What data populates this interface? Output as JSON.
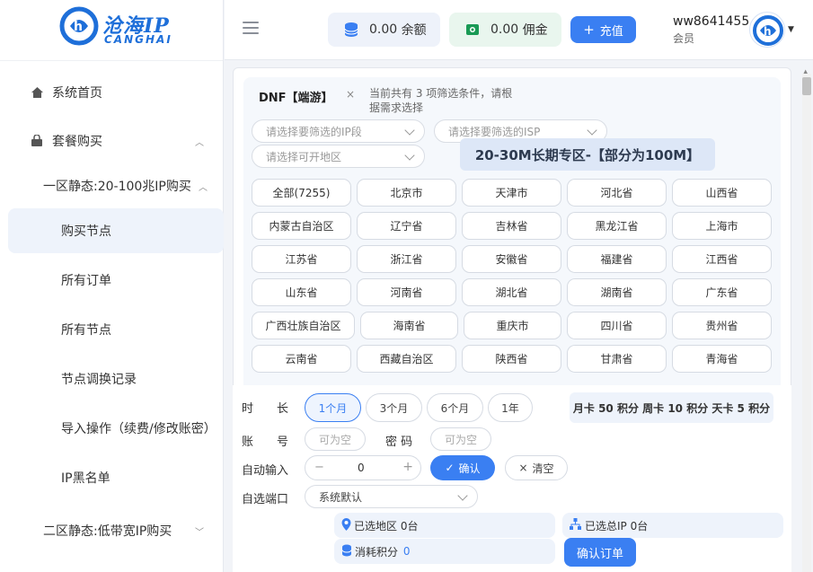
{
  "brand": {
    "title": "沧海IP",
    "subtitle": "CANGHAI"
  },
  "sidebar": {
    "items": [
      {
        "label": "系统首页",
        "icon": "home-icon"
      },
      {
        "label": "套餐购买",
        "icon": "bag-icon",
        "expanded": true
      },
      {
        "label": "一区静态:20-100兆IP购买",
        "expanded": true
      },
      {
        "label": "购买节点",
        "active": true
      },
      {
        "label": "所有订单"
      },
      {
        "label": "所有节点"
      },
      {
        "label": "节点调换记录"
      },
      {
        "label": "导入操作（续费/修改账密）"
      },
      {
        "label": "IP黑名单"
      },
      {
        "label": "二区静态:低带宽IP购买",
        "expanded": false
      }
    ]
  },
  "header": {
    "balance": {
      "value": "0.00",
      "label": "余额",
      "icon": "coins-icon"
    },
    "commission": {
      "value": "0.00",
      "label": "佣金",
      "icon": "cash-icon"
    },
    "recharge_label": "充值",
    "user": {
      "name": "ww8641455",
      "role": "会员"
    }
  },
  "filter": {
    "game": "DNF【端游】",
    "close": "×",
    "hint": "当前共有 3 项筛选条件，请根据需求选择",
    "ip_segment_placeholder": "请选择要筛选的IP段",
    "isp_placeholder": "请选择要筛选的ISP",
    "region_placeholder": "请选择可开地区",
    "banner": "20-30M长期专区-【部分为100M】",
    "regions": [
      "全部(7255)",
      "北京市",
      "天津市",
      "河北省",
      "山西省",
      "内蒙古自治区",
      "辽宁省",
      "吉林省",
      "黑龙江省",
      "上海市",
      "江苏省",
      "浙江省",
      "安徽省",
      "福建省",
      "江西省",
      "山东省",
      "河南省",
      "湖北省",
      "湖南省",
      "广东省",
      "广西壮族自治区",
      "海南省",
      "重庆市",
      "四川省",
      "贵州省",
      "云南省",
      "西藏自治区",
      "陕西省",
      "甘肃省",
      "青海省"
    ]
  },
  "form": {
    "duration_label": "时　　长",
    "durations": [
      "1个月",
      "3个月",
      "6个月",
      "1年"
    ],
    "selected_duration": "1个月",
    "points_note": "月卡 50 积分 周卡 10 积分 天卡 5 积分",
    "account_label": "账　　号",
    "account_placeholder": "可为空",
    "password_label": "密 码",
    "password_placeholder": "可为空",
    "auto_input_label": "自动输入",
    "stepper": {
      "minus": "−",
      "value": "0",
      "plus": "+"
    },
    "confirm_label": "确认",
    "clear_label": "清空",
    "port_label": "自选端口",
    "port_value": "系统默认",
    "selected_region_label": "已选地区",
    "selected_region_value": "0台",
    "selected_ip_label": "已选总IP",
    "selected_ip_value": "0台",
    "points_used_label": "消耗积分",
    "points_used_value": "0",
    "order_label": "确认订单"
  },
  "colors": {
    "primary": "#3a7ff2",
    "brand": "#1e6fd9"
  }
}
